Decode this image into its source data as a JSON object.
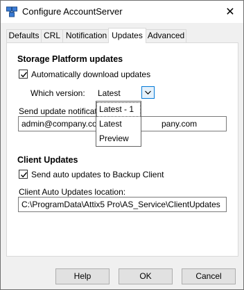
{
  "window": {
    "title": "Configure AccountServer",
    "close_glyph": "✕"
  },
  "tabs": [
    {
      "label": "Defaults",
      "active": false
    },
    {
      "label": "CRL",
      "active": false
    },
    {
      "label": "Notification",
      "active": false
    },
    {
      "label": "Updates",
      "active": true
    },
    {
      "label": "Advanced",
      "active": false
    }
  ],
  "storage": {
    "section_title": "Storage Platform updates",
    "auto_download_label": "Automatically download updates",
    "auto_download_checked": true,
    "which_version_label": "Which version:",
    "which_version_value": "Latest",
    "send_notification_label": "Send update notificatio",
    "send_notification_value_left": "admin@company.com;",
    "send_notification_value_right": "pany.com"
  },
  "version_dropdown": {
    "options": [
      "Latest - 1",
      "Latest",
      "Preview"
    ],
    "highlighted_index": 0
  },
  "client": {
    "section_title": "Client Updates",
    "send_auto_label": "Send auto updates to Backup Client",
    "send_auto_checked": true,
    "location_label": "Client Auto Updates location:",
    "location_value": "C:\\ProgramData\\Attix5 Pro\\AS_Service\\ClientUpdates"
  },
  "buttons": {
    "help": "Help",
    "ok": "OK",
    "cancel": "Cancel"
  },
  "colors": {
    "accent": "#0078d7",
    "window_bg": "#f0f0f0",
    "panel_bg": "#ffffff"
  },
  "icons": {
    "app": "network-server-icon",
    "close": "close-icon",
    "checkbox": "checkmark-icon",
    "combo": "chevron-down-icon"
  }
}
